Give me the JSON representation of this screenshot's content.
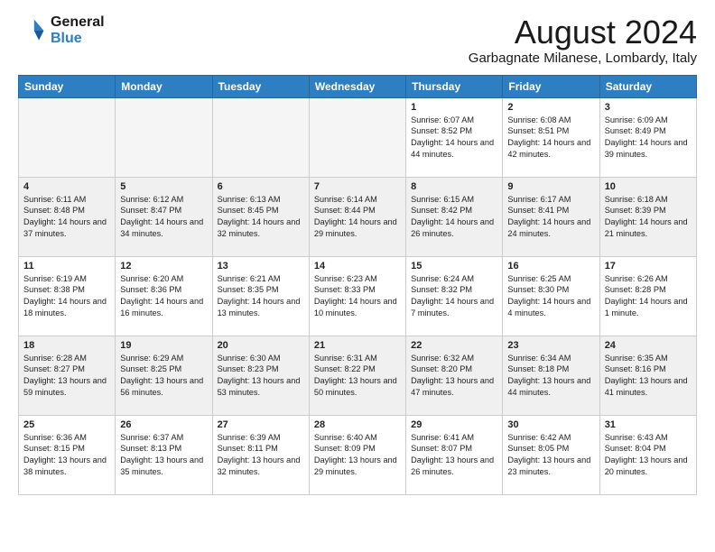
{
  "header": {
    "logo_line1": "General",
    "logo_line2": "Blue",
    "month_year": "August 2024",
    "location": "Garbagnate Milanese, Lombardy, Italy"
  },
  "days_of_week": [
    "Sunday",
    "Monday",
    "Tuesday",
    "Wednesday",
    "Thursday",
    "Friday",
    "Saturday"
  ],
  "weeks": [
    [
      {
        "day": "",
        "info": ""
      },
      {
        "day": "",
        "info": ""
      },
      {
        "day": "",
        "info": ""
      },
      {
        "day": "",
        "info": ""
      },
      {
        "day": "1",
        "info": "Sunrise: 6:07 AM\nSunset: 8:52 PM\nDaylight: 14 hours and 44 minutes."
      },
      {
        "day": "2",
        "info": "Sunrise: 6:08 AM\nSunset: 8:51 PM\nDaylight: 14 hours and 42 minutes."
      },
      {
        "day": "3",
        "info": "Sunrise: 6:09 AM\nSunset: 8:49 PM\nDaylight: 14 hours and 39 minutes."
      }
    ],
    [
      {
        "day": "4",
        "info": "Sunrise: 6:11 AM\nSunset: 8:48 PM\nDaylight: 14 hours and 37 minutes."
      },
      {
        "day": "5",
        "info": "Sunrise: 6:12 AM\nSunset: 8:47 PM\nDaylight: 14 hours and 34 minutes."
      },
      {
        "day": "6",
        "info": "Sunrise: 6:13 AM\nSunset: 8:45 PM\nDaylight: 14 hours and 32 minutes."
      },
      {
        "day": "7",
        "info": "Sunrise: 6:14 AM\nSunset: 8:44 PM\nDaylight: 14 hours and 29 minutes."
      },
      {
        "day": "8",
        "info": "Sunrise: 6:15 AM\nSunset: 8:42 PM\nDaylight: 14 hours and 26 minutes."
      },
      {
        "day": "9",
        "info": "Sunrise: 6:17 AM\nSunset: 8:41 PM\nDaylight: 14 hours and 24 minutes."
      },
      {
        "day": "10",
        "info": "Sunrise: 6:18 AM\nSunset: 8:39 PM\nDaylight: 14 hours and 21 minutes."
      }
    ],
    [
      {
        "day": "11",
        "info": "Sunrise: 6:19 AM\nSunset: 8:38 PM\nDaylight: 14 hours and 18 minutes."
      },
      {
        "day": "12",
        "info": "Sunrise: 6:20 AM\nSunset: 8:36 PM\nDaylight: 14 hours and 16 minutes."
      },
      {
        "day": "13",
        "info": "Sunrise: 6:21 AM\nSunset: 8:35 PM\nDaylight: 14 hours and 13 minutes."
      },
      {
        "day": "14",
        "info": "Sunrise: 6:23 AM\nSunset: 8:33 PM\nDaylight: 14 hours and 10 minutes."
      },
      {
        "day": "15",
        "info": "Sunrise: 6:24 AM\nSunset: 8:32 PM\nDaylight: 14 hours and 7 minutes."
      },
      {
        "day": "16",
        "info": "Sunrise: 6:25 AM\nSunset: 8:30 PM\nDaylight: 14 hours and 4 minutes."
      },
      {
        "day": "17",
        "info": "Sunrise: 6:26 AM\nSunset: 8:28 PM\nDaylight: 14 hours and 1 minute."
      }
    ],
    [
      {
        "day": "18",
        "info": "Sunrise: 6:28 AM\nSunset: 8:27 PM\nDaylight: 13 hours and 59 minutes."
      },
      {
        "day": "19",
        "info": "Sunrise: 6:29 AM\nSunset: 8:25 PM\nDaylight: 13 hours and 56 minutes."
      },
      {
        "day": "20",
        "info": "Sunrise: 6:30 AM\nSunset: 8:23 PM\nDaylight: 13 hours and 53 minutes."
      },
      {
        "day": "21",
        "info": "Sunrise: 6:31 AM\nSunset: 8:22 PM\nDaylight: 13 hours and 50 minutes."
      },
      {
        "day": "22",
        "info": "Sunrise: 6:32 AM\nSunset: 8:20 PM\nDaylight: 13 hours and 47 minutes."
      },
      {
        "day": "23",
        "info": "Sunrise: 6:34 AM\nSunset: 8:18 PM\nDaylight: 13 hours and 44 minutes."
      },
      {
        "day": "24",
        "info": "Sunrise: 6:35 AM\nSunset: 8:16 PM\nDaylight: 13 hours and 41 minutes."
      }
    ],
    [
      {
        "day": "25",
        "info": "Sunrise: 6:36 AM\nSunset: 8:15 PM\nDaylight: 13 hours and 38 minutes."
      },
      {
        "day": "26",
        "info": "Sunrise: 6:37 AM\nSunset: 8:13 PM\nDaylight: 13 hours and 35 minutes."
      },
      {
        "day": "27",
        "info": "Sunrise: 6:39 AM\nSunset: 8:11 PM\nDaylight: 13 hours and 32 minutes."
      },
      {
        "day": "28",
        "info": "Sunrise: 6:40 AM\nSunset: 8:09 PM\nDaylight: 13 hours and 29 minutes."
      },
      {
        "day": "29",
        "info": "Sunrise: 6:41 AM\nSunset: 8:07 PM\nDaylight: 13 hours and 26 minutes."
      },
      {
        "day": "30",
        "info": "Sunrise: 6:42 AM\nSunset: 8:05 PM\nDaylight: 13 hours and 23 minutes."
      },
      {
        "day": "31",
        "info": "Sunrise: 6:43 AM\nSunset: 8:04 PM\nDaylight: 13 hours and 20 minutes."
      }
    ]
  ]
}
